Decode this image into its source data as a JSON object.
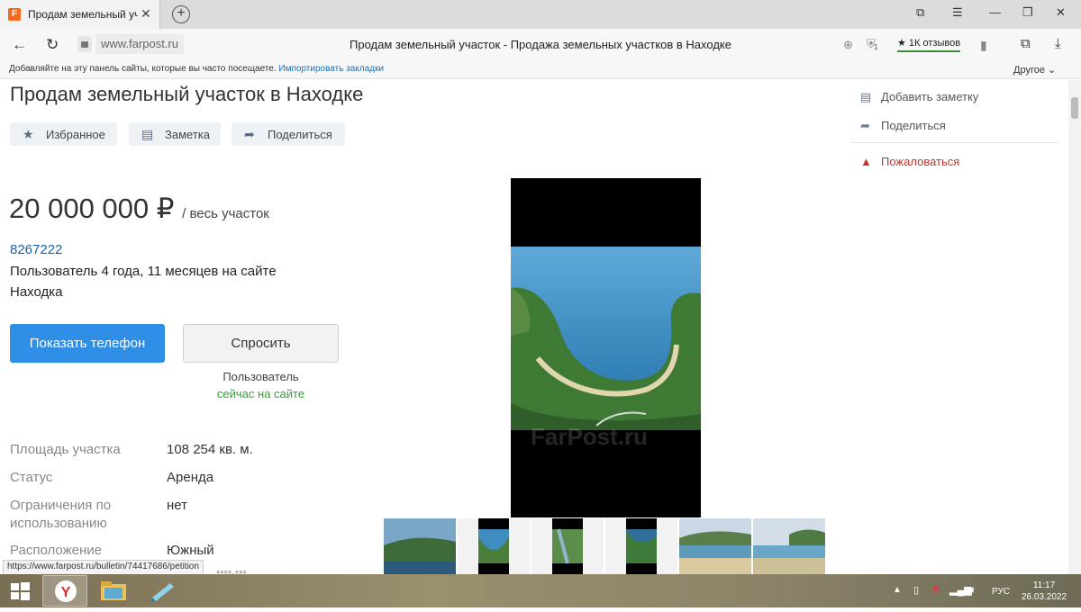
{
  "browser": {
    "tab_title": "Продам земельный уча",
    "favicon_letter": "F",
    "url": "www.farpost.ru",
    "page_title": "Продам земельный участок - Продажа земельных участков в Находке",
    "reviews": "1К отзывов",
    "bookmarks_hint": "Добавляйте на эту панель сайты, которые вы часто посещаете.",
    "bookmarks_import": "Импортировать закладки",
    "bookmarks_other": "Другое",
    "protect_badge": "1"
  },
  "listing": {
    "title": "Продам земельный участок в Находке",
    "actions": {
      "favorite": "Избранное",
      "note": "Заметка",
      "share": "Поделиться"
    },
    "price": "20 000 000 ₽",
    "price_unit": "/ весь участок",
    "seller_id": "8267222",
    "seller_since": "Пользователь 4 года, 11 месяцев на сайте",
    "seller_city": "Находка",
    "show_phone": "Показать телефон",
    "ask": "Спросить",
    "presence_label": "Пользователь",
    "presence_status": "сейчас на сайте",
    "details": [
      {
        "label": "Площадь участка",
        "value": "108 254 кв. м."
      },
      {
        "label": "Статус",
        "value": "Аренда"
      },
      {
        "label": "Ограничения по использованию",
        "value": "нет"
      },
      {
        "label": "Расположение",
        "value": "Южный"
      }
    ],
    "watermark": "FarPost.ru",
    "masked_phone": "****-***"
  },
  "sidebar": {
    "add_note": "Добавить заметку",
    "share": "Поделиться",
    "complain": "Пожаловаться"
  },
  "status_url": "https://www.farpost.ru/bulletin/74417686/petition",
  "taskbar": {
    "lang": "РУС",
    "time": "11:17",
    "date": "26.03.2022"
  },
  "colors": {
    "accent_blue": "#2f8ee5",
    "link_blue": "#1a5fa8",
    "online_green": "#3a9a3a",
    "complain_red": "#c0392b"
  }
}
